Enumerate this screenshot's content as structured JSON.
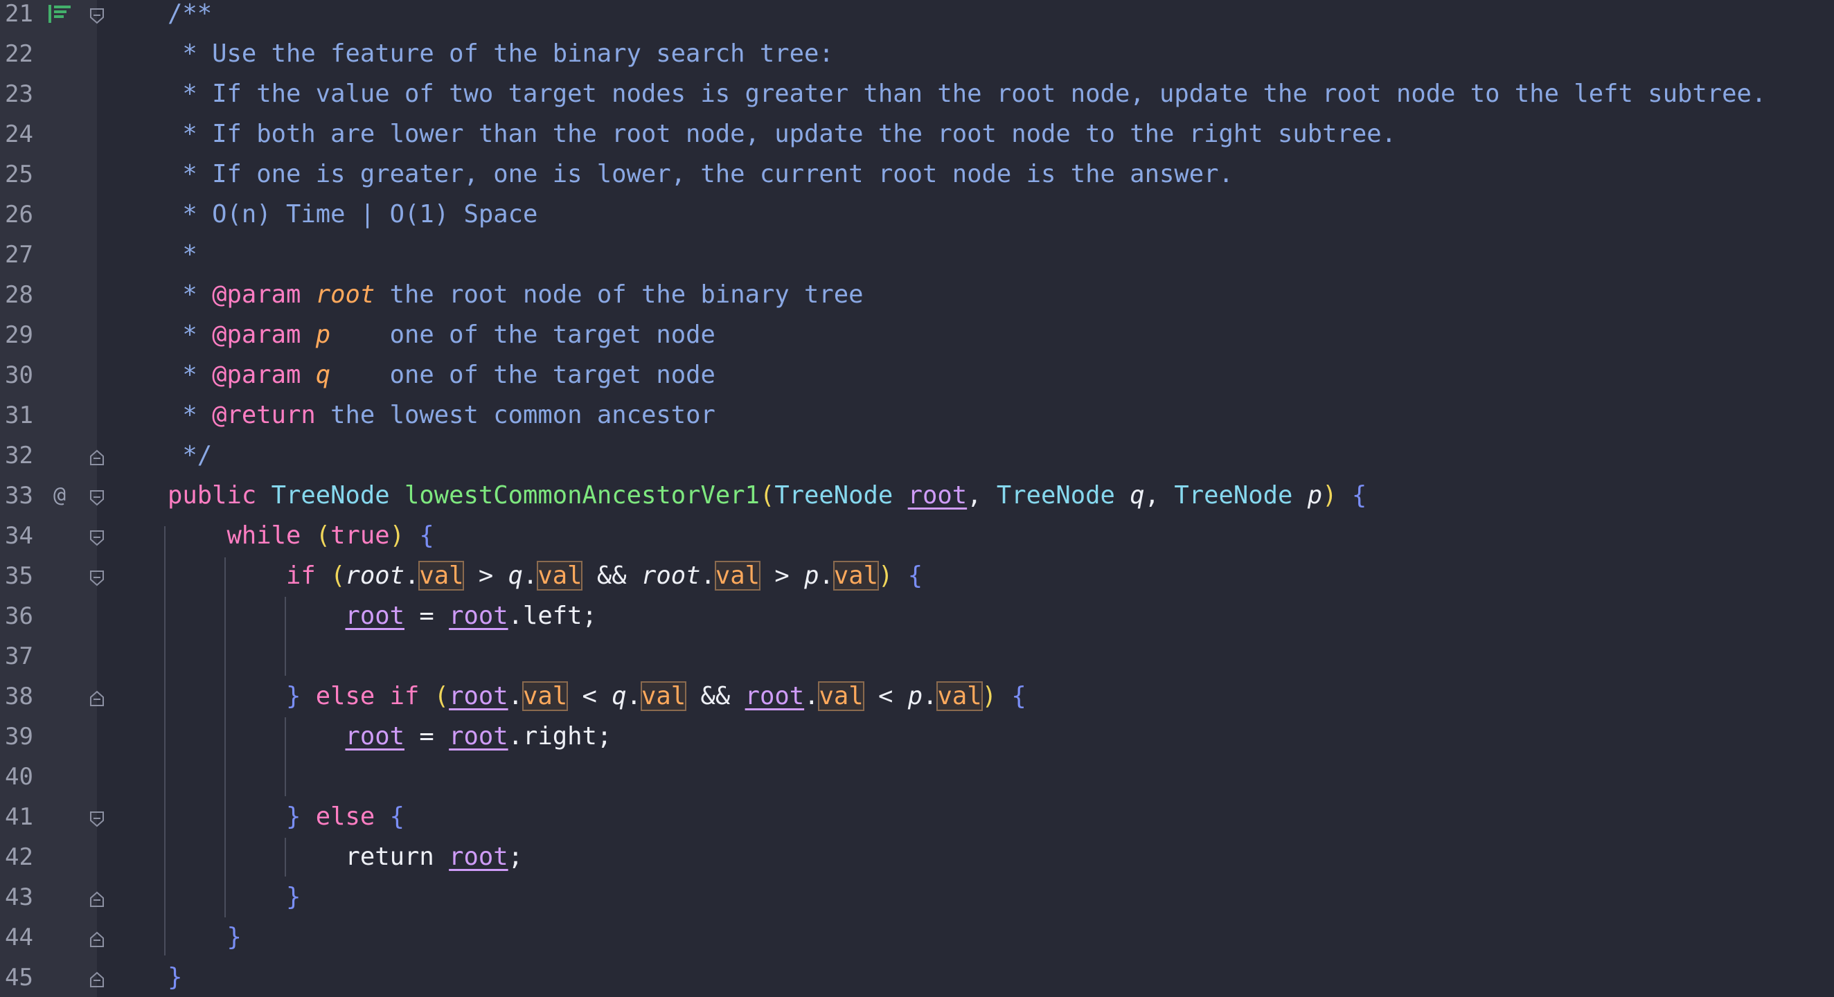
{
  "editor": {
    "language": "Java",
    "colors": {
      "background": "#272935",
      "gutter": "#31333f",
      "comment": "#8aa8e4",
      "keyword": "#ff7ec3",
      "type": "#86d8ee",
      "function": "#7ee87f",
      "param_name": "#ffa95c",
      "brace": "#7a8ef5",
      "paren": "#f0d65a",
      "local_var": "#cf9cf8"
    },
    "gutter_markers": {
      "line21": "reader-mode-icon",
      "line33": "override-icon"
    },
    "lines": [
      {
        "n": "21",
        "tokens": [
          "/**"
        ]
      },
      {
        "n": "22",
        "tokens": [
          " * Use the feature of the binary search tree:"
        ]
      },
      {
        "n": "23",
        "tokens": [
          " * If the value of two target nodes is greater than the root node, update the root node to the left subtree."
        ]
      },
      {
        "n": "24",
        "tokens": [
          " * If both are lower than the root node, update the root node to the right subtree."
        ]
      },
      {
        "n": "25",
        "tokens": [
          " * If one is greater, one is lower, the current root node is the answer."
        ]
      },
      {
        "n": "26",
        "tokens": [
          " * O(n) Time | O(1) Space"
        ]
      },
      {
        "n": "27",
        "tokens": [
          " *"
        ]
      },
      {
        "n": "28",
        "tokens": [
          " * ",
          "@param",
          " ",
          "root",
          " the root node of the binary tree"
        ]
      },
      {
        "n": "29",
        "tokens": [
          " * ",
          "@param",
          " ",
          "p",
          "    one of the target node"
        ]
      },
      {
        "n": "30",
        "tokens": [
          " * ",
          "@param",
          " ",
          "q",
          "    one of the target node"
        ]
      },
      {
        "n": "31",
        "tokens": [
          " * ",
          "@return",
          " the lowest common ancestor"
        ]
      },
      {
        "n": "32",
        "tokens": [
          " */"
        ]
      },
      {
        "n": "33",
        "tokens": [
          "public",
          " ",
          "TreeNode",
          " ",
          "lowestCommonAncestorVer1",
          "(",
          "TreeNode",
          " ",
          "root",
          ", ",
          "TreeNode",
          " ",
          "q",
          ", ",
          "TreeNode",
          " ",
          "p",
          ")",
          " ",
          "{"
        ]
      },
      {
        "n": "34",
        "tokens": [
          "    ",
          "while",
          " ",
          "(",
          "true",
          ")",
          " ",
          "{"
        ]
      },
      {
        "n": "35",
        "tokens": [
          "        ",
          "if",
          " ",
          "(",
          "root",
          ".",
          "val",
          " > ",
          "q",
          ".",
          "val",
          " && ",
          "root",
          ".",
          "val",
          " > ",
          "p",
          ".",
          "val",
          ")",
          " ",
          "{"
        ]
      },
      {
        "n": "36",
        "tokens": [
          "            ",
          "root",
          " = ",
          "root",
          ".left;"
        ]
      },
      {
        "n": "37",
        "tokens": [
          ""
        ]
      },
      {
        "n": "38",
        "tokens": [
          "        ",
          "}",
          " ",
          "else",
          " ",
          "if",
          " ",
          "(",
          "root",
          ".",
          "val",
          " < ",
          "q",
          ".",
          "val",
          " && ",
          "root",
          ".",
          "val",
          " < ",
          "p",
          ".",
          "val",
          ")",
          " ",
          "{"
        ]
      },
      {
        "n": "39",
        "tokens": [
          "            ",
          "root",
          " = ",
          "root",
          ".right;"
        ]
      },
      {
        "n": "40",
        "tokens": [
          ""
        ]
      },
      {
        "n": "41",
        "tokens": [
          "        ",
          "}",
          " ",
          "else",
          " ",
          "{"
        ]
      },
      {
        "n": "42",
        "tokens": [
          "            ",
          "return",
          " ",
          "root",
          ";"
        ]
      },
      {
        "n": "43",
        "tokens": [
          "        ",
          "}"
        ]
      },
      {
        "n": "44",
        "tokens": [
          "    ",
          "}"
        ]
      },
      {
        "n": "45",
        "tokens": [
          "}"
        ]
      }
    ]
  }
}
